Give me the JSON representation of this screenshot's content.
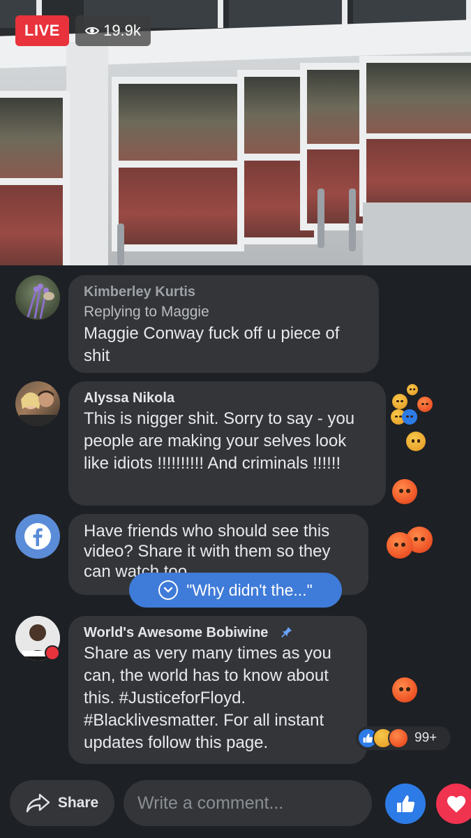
{
  "live": {
    "badge": "LIVE",
    "viewers": "19.9k"
  },
  "comments": [
    {
      "name": "Kimberley Kurtis",
      "reply_to": "Replying to Maggie",
      "text": "Maggie Conway fuck off u piece of shit"
    },
    {
      "name": "Alyssa Nikola",
      "text": "This is nigger shit. Sorry to say - you people are making your selves look like idiots !!!!!!!!!! And criminals !!!!!!"
    },
    {
      "text": "Have friends who should see this video? Share it with them so they can watch too."
    },
    {
      "name": "World's Awesome Bobiwine",
      "text": "Share as very many times as you can, the world has to know about this. #JusticeforFloyd. #Blacklivesmatter. For all instant updates follow this page."
    }
  ],
  "jump_pill": {
    "label": "\"Why didn't the...\""
  },
  "reactions": {
    "count": "99+"
  },
  "bottom_bar": {
    "share_label": "Share",
    "comment_placeholder": "Write a comment..."
  },
  "colors": {
    "live_red": "#e8323c",
    "facebook_blue": "#2d7be6",
    "love_red": "#f0334f",
    "bubble": "#333538",
    "background": "#1d2024"
  },
  "icons": [
    "eye-icon",
    "facebook-logo-icon",
    "pin-icon",
    "chevron-down-icon",
    "share-arrow-icon",
    "thumbs-up-icon",
    "heart-icon"
  ]
}
